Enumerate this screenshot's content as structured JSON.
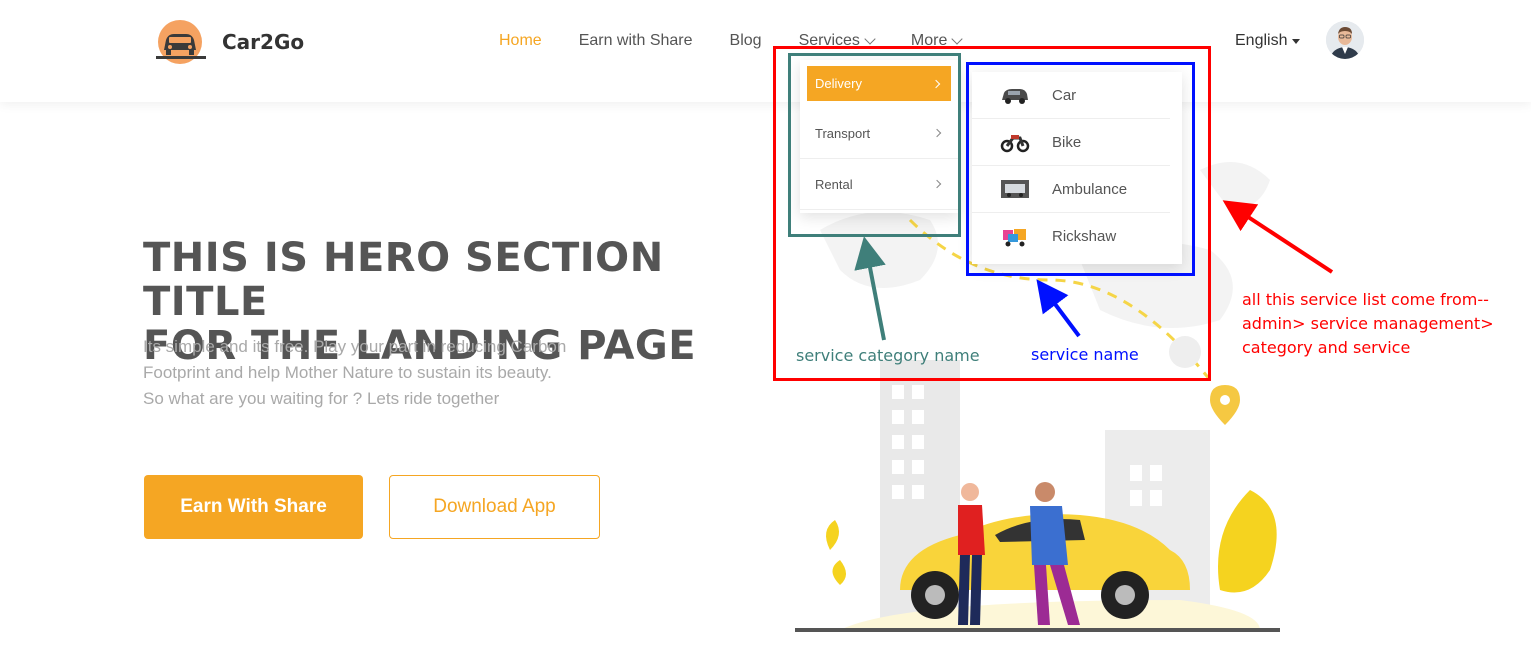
{
  "brand": {
    "name": "Car2Go"
  },
  "nav": {
    "items": [
      {
        "label": "Home"
      },
      {
        "label": "Earn with Share"
      },
      {
        "label": "Blog"
      },
      {
        "label": "Services"
      },
      {
        "label": "More"
      }
    ],
    "active": "Home",
    "language": "English"
  },
  "hero": {
    "title_line1": "THIS IS HERO SECTION TITLE",
    "title_line2": "FOR THE LANDING PAGE",
    "subtitle_line1": "Its simple and its free. Play your part in reducing Carbon",
    "subtitle_line2": "Footprint and help Mother Nature to sustain its beauty.",
    "subtitle_line3": "So what are you waiting for ? Lets ride together",
    "primary_button": "Earn With Share",
    "secondary_button": "Download App"
  },
  "services_menu": {
    "categories": [
      {
        "label": "Delivery",
        "active": true
      },
      {
        "label": "Transport",
        "active": false
      },
      {
        "label": "Rental",
        "active": false
      }
    ],
    "services": [
      {
        "label": "Car",
        "icon": "car-icon"
      },
      {
        "label": "Bike",
        "icon": "bike-icon"
      },
      {
        "label": "Ambulance",
        "icon": "ambulance-icon"
      },
      {
        "label": "Rickshaw",
        "icon": "rickshaw-icon"
      }
    ]
  },
  "annotations": {
    "category_label": "service category name",
    "service_label": "service name",
    "note_line1": "all this service list come from--",
    "note_line2": "admin> service management>",
    "note_line3": "category and service"
  },
  "colors": {
    "accent": "#f5a623",
    "annotation_red": "#ff0000",
    "annotation_teal": "#3f7f7a",
    "annotation_blue": "#0010ff"
  }
}
